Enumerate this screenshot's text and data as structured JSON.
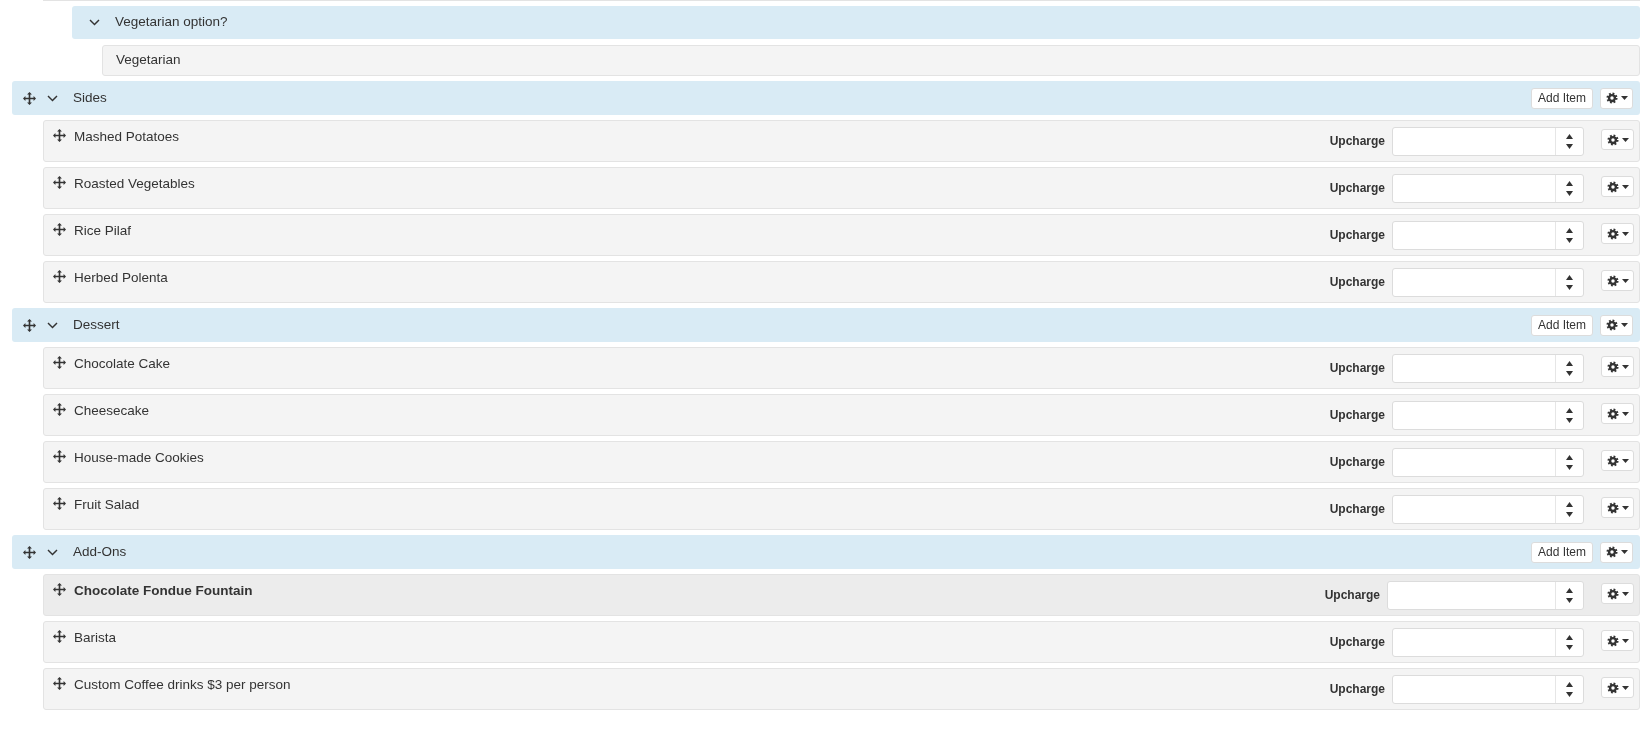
{
  "option_group": {
    "title": "Vegetarian option?",
    "expanded": true,
    "choices": [
      {
        "label": "Vegetarian"
      }
    ]
  },
  "sections": [
    {
      "title": "Sides",
      "expanded": true,
      "add_button": "Add Item",
      "items": [
        {
          "name": "Mashed Potatoes",
          "upcharge_label": "Upcharge",
          "highlighted": false
        },
        {
          "name": "Roasted Vegetables",
          "upcharge_label": "Upcharge",
          "highlighted": false
        },
        {
          "name": "Rice Pilaf",
          "upcharge_label": "Upcharge",
          "highlighted": false
        },
        {
          "name": "Herbed Polenta",
          "upcharge_label": "Upcharge",
          "highlighted": false
        }
      ]
    },
    {
      "title": "Dessert",
      "expanded": true,
      "add_button": "Add Item",
      "items": [
        {
          "name": "Chocolate Cake",
          "upcharge_label": "Upcharge",
          "highlighted": false
        },
        {
          "name": "Cheesecake",
          "upcharge_label": "Upcharge",
          "highlighted": false
        },
        {
          "name": "House-made Cookies",
          "upcharge_label": "Upcharge",
          "highlighted": false
        },
        {
          "name": "Fruit Salad",
          "upcharge_label": "Upcharge",
          "highlighted": false
        }
      ]
    },
    {
      "title": "Add-Ons",
      "expanded": true,
      "add_button": "Add Item",
      "items": [
        {
          "name": "Chocolate Fondue Fountain",
          "upcharge_label": "Upcharge",
          "highlighted": true
        },
        {
          "name": "Barista",
          "upcharge_label": "Upcharge",
          "highlighted": false
        },
        {
          "name": "Custom Coffee drinks $3 per person",
          "upcharge_label": "Upcharge",
          "highlighted": false
        }
      ]
    }
  ]
}
